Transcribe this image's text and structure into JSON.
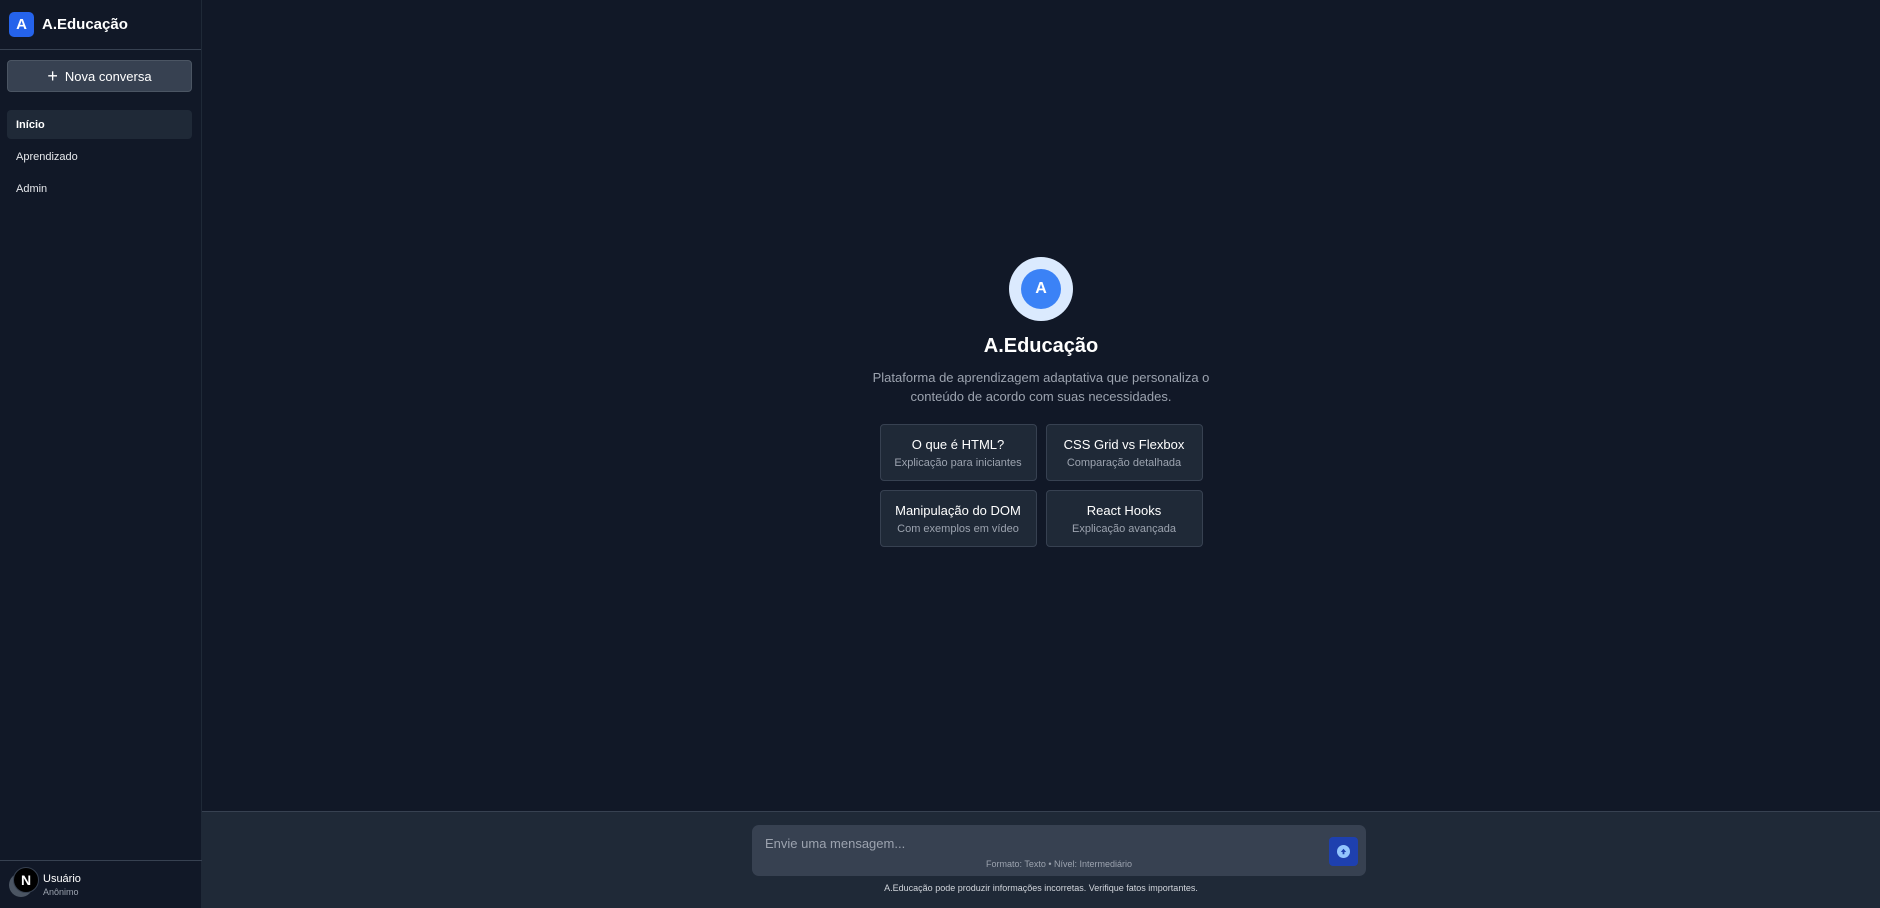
{
  "brand": {
    "logo_letter": "A",
    "name": "A.Educação"
  },
  "sidebar": {
    "new_chat_icon": "plus-icon",
    "new_chat_label": "Nova conversa",
    "items": [
      {
        "label": "Início",
        "active": true
      },
      {
        "label": "Aprendizado",
        "active": false
      },
      {
        "label": "Admin",
        "active": false
      }
    ],
    "user": {
      "badge": "N",
      "name": "Usuário",
      "status": "Anônimo"
    }
  },
  "hero": {
    "logo_letter": "A",
    "title": "A.Educação",
    "description": "Plataforma de aprendizagem adaptativa que personaliza o conteúdo de acordo com suas necessidades.",
    "cards": [
      {
        "title": "O que é HTML?",
        "subtitle": "Explicação para iniciantes"
      },
      {
        "title": "CSS Grid vs Flexbox",
        "subtitle": "Comparação detalhada"
      },
      {
        "title": "Manipulação do DOM",
        "subtitle": "Com exemplos em vídeo"
      },
      {
        "title": "React Hooks",
        "subtitle": "Explicação avançada"
      }
    ]
  },
  "composer": {
    "placeholder": "Envie uma mensagem...",
    "value": "",
    "meta": "Formato: Texto • Nível: Intermediário",
    "send_icon": "send-icon",
    "disclaimer": "A.Educação pode produzir informações incorretas. Verifique fatos importantes."
  },
  "colors": {
    "background": "#111827",
    "panel": "#1f2937",
    "accent": "#2563eb",
    "send_button": "#1e40af"
  }
}
